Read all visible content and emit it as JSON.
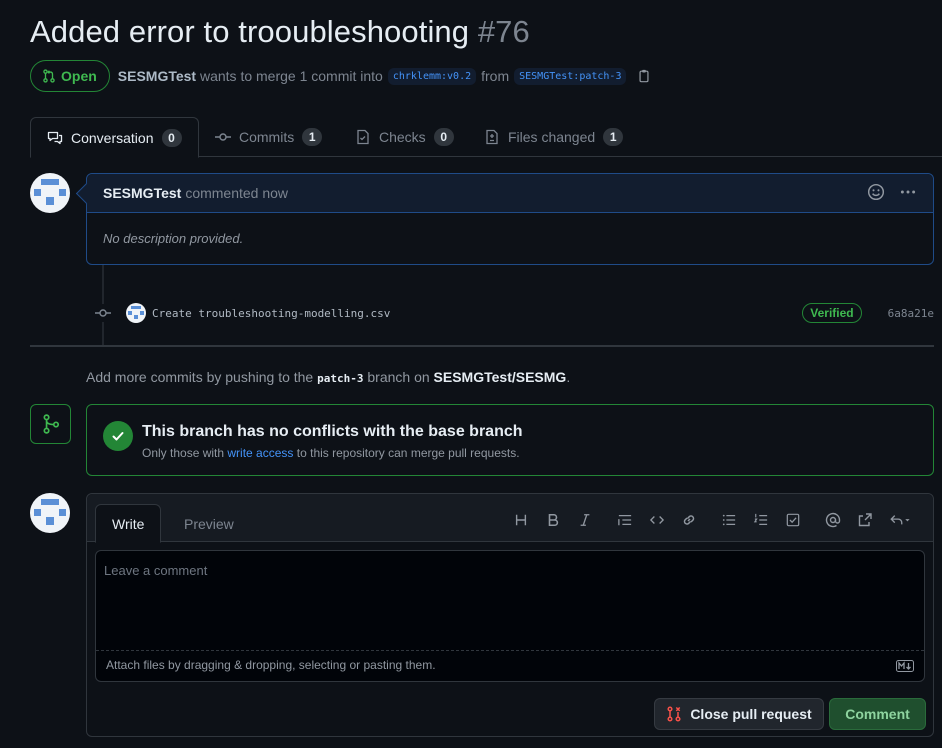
{
  "pr": {
    "title": "Added error to trooubleshooting",
    "number": "#76",
    "state": "Open",
    "author": "SESMGTest",
    "merge_text": "wants to merge 1 commit into",
    "base_branch": "chrklemm:v0.2",
    "from_text": "from",
    "head_branch": "SESMGTest:patch-3"
  },
  "tabs": [
    {
      "label": "Conversation",
      "count": "0"
    },
    {
      "label": "Commits",
      "count": "1"
    },
    {
      "label": "Checks",
      "count": "0"
    },
    {
      "label": "Files changed",
      "count": "1"
    }
  ],
  "comment": {
    "author": "SESMGTest",
    "action": "commented now",
    "body": "No description provided."
  },
  "commit": {
    "message": "Create troubleshooting-modelling.csv",
    "verified": "Verified",
    "sha": "6a8a21e"
  },
  "push_hint": {
    "prefix": "Add more commits by pushing to the",
    "branch": "patch-3",
    "middle": "branch on",
    "repo": "SESMGTest/SESMG",
    "suffix": "."
  },
  "merge": {
    "heading": "This branch has no conflicts with the base branch",
    "sub_prefix": "Only those with",
    "sub_link": "write access",
    "sub_suffix": "to this repository can merge pull requests."
  },
  "new_comment": {
    "tab_write": "Write",
    "tab_preview": "Preview",
    "placeholder": "Leave a comment",
    "attach": "Attach files by dragging & dropping, selecting or pasting them.",
    "close_label": "Close pull request",
    "comment_label": "Comment"
  },
  "colors": {
    "open_green": "#3fb950",
    "link_blue": "#4493f8",
    "close_red": "#f85149"
  }
}
